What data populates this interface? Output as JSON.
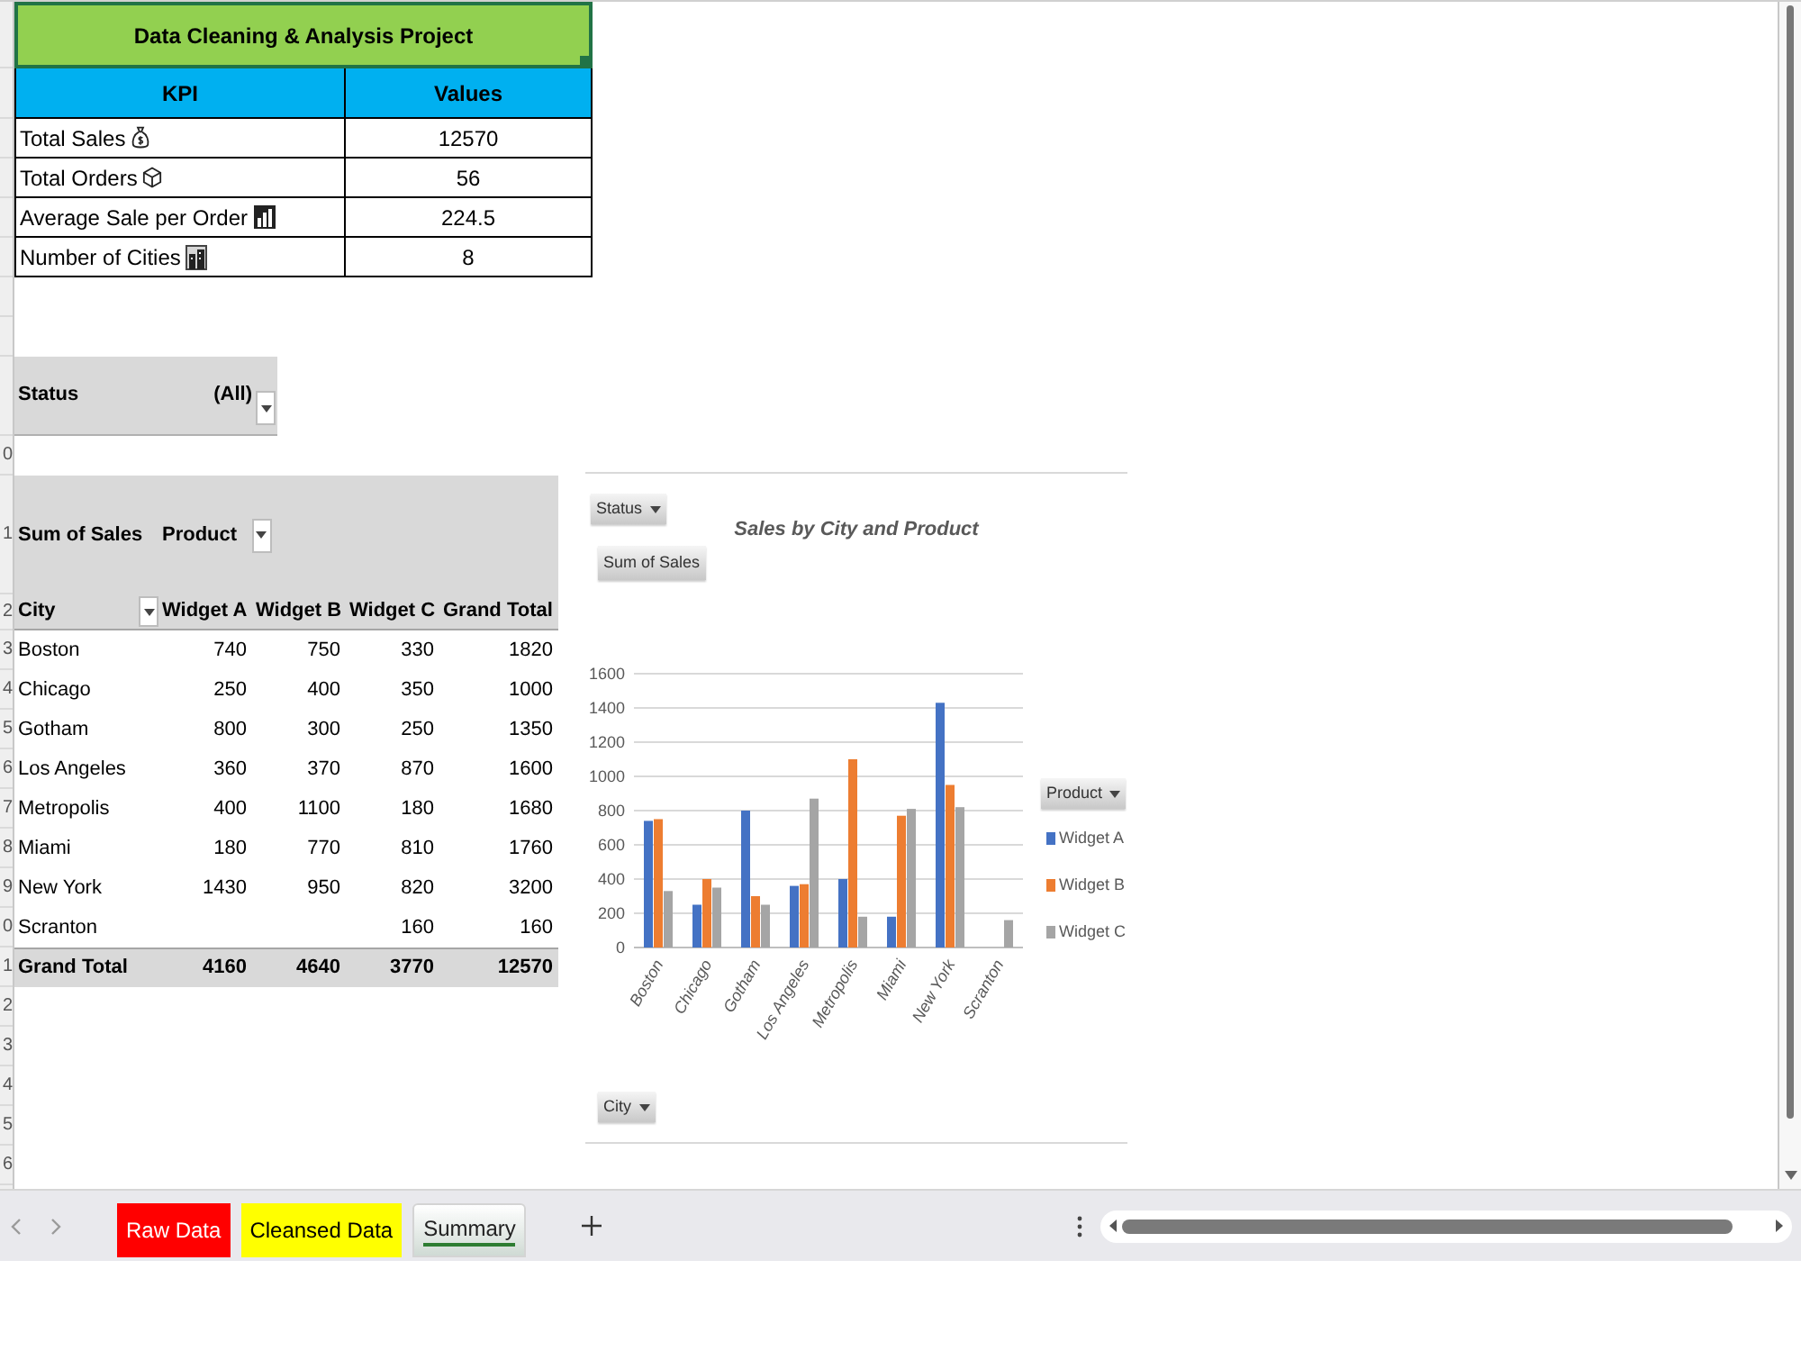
{
  "sheet": {
    "row_numbers": [
      "0",
      "1",
      "2",
      "3",
      "4",
      "5",
      "6",
      "7",
      "8",
      "9",
      "0",
      "1",
      "2",
      "3",
      "4",
      "5",
      "6"
    ]
  },
  "kpi_table": {
    "title": {
      "text": "Data Cleaning & Analysis Project",
      "selected": true
    },
    "columns": [
      "KPI",
      "Values"
    ],
    "rows": [
      {
        "label": "Total Sales",
        "value": "12570"
      },
      {
        "label": "Total Orders",
        "value": "56"
      },
      {
        "label": "Average Sale per Order",
        "value": "224.5"
      },
      {
        "label": "Number of Cities",
        "value": "8"
      }
    ]
  },
  "report_filter": {
    "field": "Status",
    "value": "(All)"
  },
  "pivot_table": {
    "value_field": "Sum of Sales",
    "column_field": "Product",
    "columns": [
      "City",
      "Widget A",
      "Widget B",
      "Widget C",
      "Grand Total"
    ],
    "rows": [
      {
        "label": "Boston",
        "widget_a": "740",
        "widget_b": "750",
        "widget_c": "330",
        "grand_total": "1820"
      },
      {
        "label": "Chicago",
        "widget_a": "250",
        "widget_b": "400",
        "widget_c": "350",
        "grand_total": "1000"
      },
      {
        "label": "Gotham",
        "widget_a": "800",
        "widget_b": "300",
        "widget_c": "250",
        "grand_total": "1350"
      },
      {
        "label": "Los Angeles",
        "widget_a": "360",
        "widget_b": "370",
        "widget_c": "870",
        "grand_total": "1600"
      },
      {
        "label": "Metropolis",
        "widget_a": "400",
        "widget_b": "1100",
        "widget_c": "180",
        "grand_total": "1680"
      },
      {
        "label": "Miami",
        "widget_a": "180",
        "widget_b": "770",
        "widget_c": "810",
        "grand_total": "1760"
      },
      {
        "label": "New York",
        "widget_a": "1430",
        "widget_b": "950",
        "widget_c": "820",
        "grand_total": "3200"
      },
      {
        "label": "Scranton",
        "widget_c": "160",
        "grand_total": "160"
      }
    ],
    "total": {
      "label": "Grand Total",
      "widget_a": "4160",
      "widget_b": "4640",
      "widget_c": "3770",
      "grand_total": "12570"
    }
  },
  "chart": {
    "field_buttons": [
      {
        "kind": "filter",
        "label": "Status"
      },
      {
        "kind": "value",
        "label": "Sum of Sales"
      },
      {
        "kind": "legend",
        "label": "Product"
      },
      {
        "kind": "axis",
        "label": "City"
      }
    ],
    "chart_data": {
      "type": "bar",
      "title": "Sales by City and Product",
      "categories": [
        "Boston",
        "Chicago",
        "Gotham",
        "Los Angeles",
        "Metropolis",
        "Miami",
        "New York",
        "Scranton"
      ],
      "series": [
        {
          "name": "Widget A",
          "color": "#4472c4",
          "values": [
            740,
            250,
            800,
            360,
            400,
            180,
            1430,
            null
          ]
        },
        {
          "name": "Widget B",
          "color": "#ed7d31",
          "values": [
            750,
            400,
            300,
            370,
            1100,
            770,
            950,
            null
          ]
        },
        {
          "name": "Widget C",
          "color": "#a5a5a5",
          "values": [
            330,
            350,
            250,
            870,
            180,
            810,
            820,
            160
          ]
        }
      ],
      "ylim": [
        0,
        1600
      ],
      "yticks": [
        0,
        200,
        400,
        600,
        800,
        1000,
        1200,
        1400,
        1600
      ],
      "grid": true,
      "legend": "right"
    }
  },
  "sheet_tabs": [
    {
      "label": "Raw Data",
      "selected": false,
      "color": "#ff0000"
    },
    {
      "label": "Cleansed Data",
      "selected": false,
      "color": "#ffff00"
    },
    {
      "label": "Summary",
      "selected": true,
      "color": "#2e7d32"
    }
  ]
}
